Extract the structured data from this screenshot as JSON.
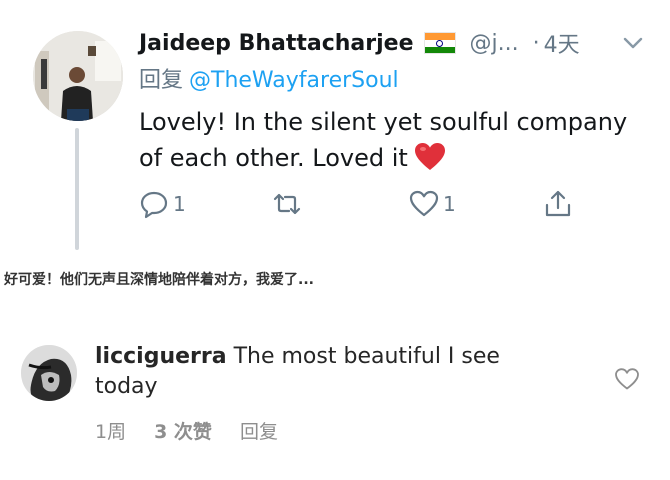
{
  "tweet": {
    "author_name": "Jaideep Bhattacharjee",
    "flag_icon": "india-flag-icon",
    "handle": "@j...",
    "separator": "·",
    "time": "4天",
    "reply_prefix": "回复",
    "reply_handle": "@TheWayfarerSoul",
    "text": "Lovely! In the silent yet soulful company of each other. Loved it",
    "emoji": "red-heart",
    "actions": {
      "reply_count": "1",
      "retweet_count": "",
      "like_count": "1"
    }
  },
  "caption": "好可爱！他们无声且深情地陪伴着对方，我爱了...",
  "comment": {
    "username": "licciguerra",
    "text": "The most beautiful I see today",
    "time": "1周",
    "likes": "3 次赞",
    "reply_label": "回复"
  },
  "colors": {
    "twitter_blue": "#1da1f2",
    "gray": "#657786",
    "heart_red": "#e0245e",
    "thread_line": "#d0d5da"
  }
}
